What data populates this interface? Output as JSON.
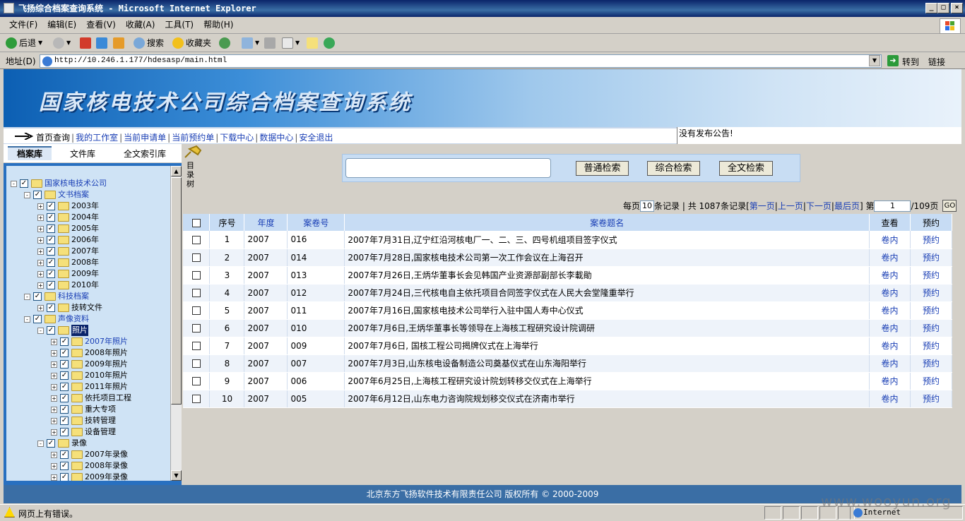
{
  "window": {
    "title": "飞扬综合档案查询系统 - Microsoft Internet Explorer",
    "minimize": "_",
    "maximize": "□",
    "close": "×"
  },
  "menu": [
    "文件(F)",
    "编辑(E)",
    "查看(V)",
    "收藏(A)",
    "工具(T)",
    "帮助(H)"
  ],
  "toolbar": {
    "back": "后退",
    "search": "搜索",
    "favorites": "收藏夹"
  },
  "address": {
    "label": "地址(D)",
    "url": "http://10.246.1.177/hdesasp/main.html",
    "go": "转到",
    "links": "链接"
  },
  "page": {
    "banner_title": "国家核电技术公司综合档案查询系统",
    "nav": [
      "首页查询",
      "我的工作室",
      "当前申请单",
      "当前预约单",
      "下载中心",
      "数据中心",
      "安全退出"
    ],
    "notice": "没有发布公告!",
    "left_tabs": [
      "档案库",
      "文件库",
      "全文索引库"
    ],
    "vertical_label": "目录树",
    "search_buttons": [
      "普通检索",
      "综合检索",
      "全文检索"
    ],
    "pager": {
      "per_page_label": "每页",
      "per_page_value": "10",
      "records_label": "条记录 | 共",
      "total": "1087条记录",
      "first": "第一页",
      "prev": "上一页",
      "next": "下一页",
      "last": "最后页",
      "page_label": "第",
      "page_value": "1",
      "total_pages": "/109页",
      "go": "GO"
    },
    "table": {
      "headers": [
        "序号",
        "年度",
        "案卷号",
        "案卷题名",
        "查看",
        "预约"
      ],
      "rows": [
        {
          "no": "1",
          "year": "2007",
          "file": "016",
          "title": "2007年7月31日,辽宁红沿河核电厂一、二、三、四号机组项目签字仪式",
          "view": "卷内",
          "reserve": "预约"
        },
        {
          "no": "2",
          "year": "2007",
          "file": "014",
          "title": "2007年7月28日,国家核电技术公司第一次工作会议在上海召开",
          "view": "卷内",
          "reserve": "预约"
        },
        {
          "no": "3",
          "year": "2007",
          "file": "013",
          "title": "2007年7月26日,王炳华董事长会见韩国产业资源部副部长李載勛",
          "view": "卷内",
          "reserve": "预约"
        },
        {
          "no": "4",
          "year": "2007",
          "file": "012",
          "title": "2007年7月24日,三代核电自主依托项目合同签字仪式在人民大会堂隆重举行",
          "view": "卷内",
          "reserve": "预约"
        },
        {
          "no": "5",
          "year": "2007",
          "file": "011",
          "title": "2007年7月16日,国家核电技术公司举行入驻中国人寿中心仪式",
          "view": "卷内",
          "reserve": "预约"
        },
        {
          "no": "6",
          "year": "2007",
          "file": "010",
          "title": "2007年7月6日,王炳华董事长等领导在上海核工程研究设计院调研",
          "view": "卷内",
          "reserve": "预约"
        },
        {
          "no": "7",
          "year": "2007",
          "file": "009",
          "title": "2007年7月6日, 国核工程公司揭牌仪式在上海举行",
          "view": "卷内",
          "reserve": "预约"
        },
        {
          "no": "8",
          "year": "2007",
          "file": "007",
          "title": "2007年7月3日,山东核电设备制造公司奠基仪式在山东海阳举行",
          "view": "卷内",
          "reserve": "预约"
        },
        {
          "no": "9",
          "year": "2007",
          "file": "006",
          "title": "2007年6月25日,上海核工程研究设计院划转移交仪式在上海举行",
          "view": "卷内",
          "reserve": "预约"
        },
        {
          "no": "10",
          "year": "2007",
          "file": "005",
          "title": "2007年6月12日,山东电力咨询院规划移交仪式在济南市举行",
          "view": "卷内",
          "reserve": "预约"
        }
      ]
    },
    "tree": [
      {
        "label": "国家核电技术公司",
        "level": 0,
        "exp": "-",
        "blue": true
      },
      {
        "label": "文书档案",
        "level": 1,
        "exp": "-",
        "blue": true
      },
      {
        "label": "2003年",
        "level": 2,
        "exp": "+"
      },
      {
        "label": "2004年",
        "level": 2,
        "exp": "+"
      },
      {
        "label": "2005年",
        "level": 2,
        "exp": "+"
      },
      {
        "label": "2006年",
        "level": 2,
        "exp": "+"
      },
      {
        "label": "2007年",
        "level": 2,
        "exp": "+"
      },
      {
        "label": "2008年",
        "level": 2,
        "exp": "+"
      },
      {
        "label": "2009年",
        "level": 2,
        "exp": "+"
      },
      {
        "label": "2010年",
        "level": 2,
        "exp": "+"
      },
      {
        "label": "科技档案",
        "level": 1,
        "exp": "-",
        "blue": true
      },
      {
        "label": "技转文件",
        "level": 2,
        "exp": "+"
      },
      {
        "label": "声像资料",
        "level": 1,
        "exp": "-",
        "blue": true
      },
      {
        "label": "照片",
        "level": 2,
        "exp": "-",
        "selected": true
      },
      {
        "label": "2007年照片",
        "level": 3,
        "exp": "+",
        "blue": true
      },
      {
        "label": "2008年照片",
        "level": 3,
        "exp": "+"
      },
      {
        "label": "2009年照片",
        "level": 3,
        "exp": "+"
      },
      {
        "label": "2010年照片",
        "level": 3,
        "exp": "+"
      },
      {
        "label": "2011年照片",
        "level": 3,
        "exp": "+"
      },
      {
        "label": "依托项目工程",
        "level": 3,
        "exp": "+"
      },
      {
        "label": "重大专项",
        "level": 3,
        "exp": "+"
      },
      {
        "label": "技转管理",
        "level": 3,
        "exp": "+"
      },
      {
        "label": "设备管理",
        "level": 3,
        "exp": "+"
      },
      {
        "label": "录像",
        "level": 2,
        "exp": "-"
      },
      {
        "label": "2007年录像",
        "level": 3,
        "exp": "+"
      },
      {
        "label": "2008年录像",
        "level": 3,
        "exp": "+"
      },
      {
        "label": "2009年录像",
        "level": 3,
        "exp": "+"
      }
    ],
    "footer": "北京东方飞扬软件技术有限责任公司 版权所有 © 2000-2009"
  },
  "status": {
    "text": "网页上有错误。",
    "zone": "Internet"
  },
  "watermark": "www.wooyun.org"
}
